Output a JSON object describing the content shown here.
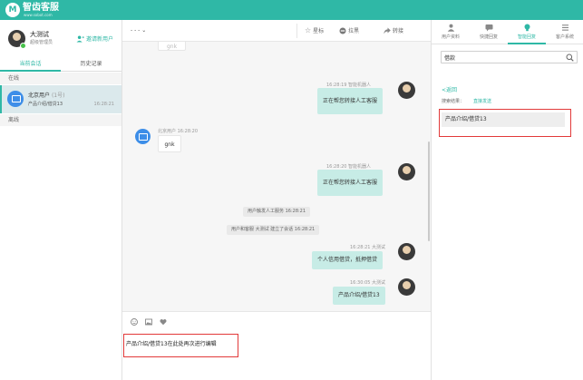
{
  "app": {
    "logo_glyph": "M",
    "brand": "智齿客服",
    "brand_sub": "www.sobot.com",
    "accent": "#2fb8a6"
  },
  "agent": {
    "name": "大测试",
    "role": "超级管理员",
    "invite_label": "邀请新用户"
  },
  "left_tabs": [
    "当前会话",
    "历史记录"
  ],
  "groups": {
    "online": "在线",
    "offline": "离线"
  },
  "session": {
    "name": "北京用户",
    "tag": "(1号)",
    "preview": "产品介绍/借贷13",
    "time": "16:28:21"
  },
  "chat_header": {
    "selector": "- - -",
    "star": "星标",
    "block": "拉黑",
    "transfer": "转接"
  },
  "messages": {
    "m0_text": "gnk",
    "m1": {
      "meta": "16:28:19  智能机器人",
      "text": "正在帮您转接人工客服"
    },
    "m2": {
      "meta": "北京用户  16:28:20",
      "text": "gnk"
    },
    "m3": {
      "meta": "16:28:20  智能机器人",
      "text": "正在帮您转接人工客服"
    },
    "sys1": "用户触发人工服务 16:28:21",
    "sys2": "用户和客服 大测试 建立了会话 16:28:21",
    "m4": {
      "meta": "16:28:21   大测试",
      "text": "个人信用借贷，抵押借贷"
    },
    "m5": {
      "meta": "16:30:05   大测试",
      "text": "产品介绍/借贷13"
    }
  },
  "editor": {
    "text": "产品介绍/借贷13在此处再次进行编辑"
  },
  "right_tabs": [
    "用户资料",
    "快捷回复",
    "智能回复",
    "客户系统"
  ],
  "right": {
    "search_value": "借款",
    "back": "<返回",
    "result_label": "搜索结果：",
    "result_link": "直接发送",
    "result_item": "产品介绍/借贷13"
  }
}
